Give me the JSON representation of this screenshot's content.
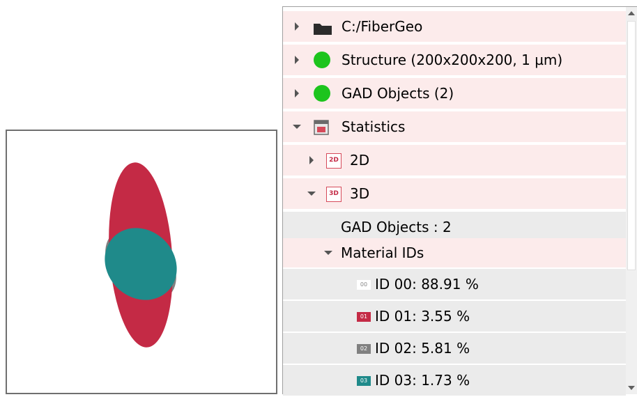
{
  "tree": {
    "root_folder": "C:/FiberGeo",
    "structure": "Structure (200x200x200, 1 µm)",
    "gad_objects": "GAD Objects (2)",
    "statistics": "Statistics",
    "stats_2d": {
      "badge": "2D",
      "label": "2D"
    },
    "stats_3d": {
      "badge": "3D",
      "label": "3D"
    },
    "gad_count": "GAD Objects : 2",
    "material_ids": "Material IDs",
    "materials": [
      {
        "badge": "00",
        "label": "ID 00: 88.91 %",
        "color": "#ffffff"
      },
      {
        "badge": "01",
        "label": "ID 01:  3.55 %",
        "color": "#c42a45"
      },
      {
        "badge": "02",
        "label": "ID 02:  5.81 %",
        "color": "#808080"
      },
      {
        "badge": "03",
        "label": "ID 03:  1.73 %",
        "color": "#1f8a8a"
      }
    ]
  },
  "colors": {
    "status_green": "#1dc41d",
    "ellipse_red": "#c42a45",
    "ellipse_grey": "#808080",
    "ellipse_teal": "#1f8a8a"
  }
}
